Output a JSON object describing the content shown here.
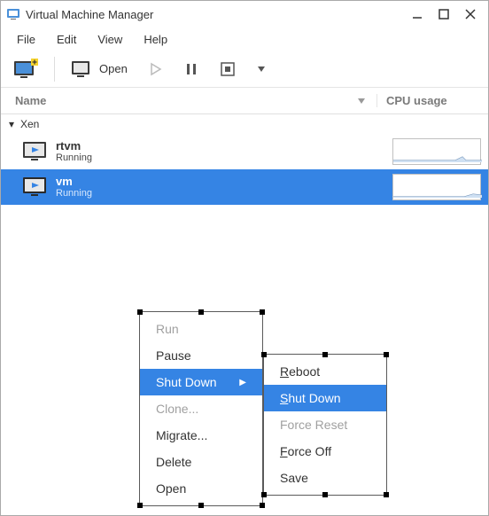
{
  "window": {
    "title": "Virtual Machine Manager"
  },
  "menubar": [
    "File",
    "Edit",
    "View",
    "Help"
  ],
  "toolbar": {
    "open_label": "Open"
  },
  "headers": {
    "name": "Name",
    "cpu": "CPU usage"
  },
  "connection": {
    "label": "Xen"
  },
  "vms": [
    {
      "name": "rtvm",
      "status": "Running",
      "selected": false
    },
    {
      "name": "vm",
      "status": "Running",
      "selected": true
    }
  ],
  "context_menu": [
    {
      "label": "Run",
      "disabled": true
    },
    {
      "label": "Pause",
      "disabled": false
    },
    {
      "label": "Shut Down",
      "disabled": false,
      "highlight": true,
      "submenu": true
    },
    {
      "label": "Clone...",
      "disabled": true
    },
    {
      "label": "Migrate...",
      "disabled": false
    },
    {
      "label": "Delete",
      "disabled": false
    },
    {
      "label": "Open",
      "disabled": false
    }
  ],
  "sub_menu": [
    {
      "label": "Reboot",
      "disabled": false
    },
    {
      "label": "Shut Down",
      "disabled": false,
      "highlight": true
    },
    {
      "label": "Force Reset",
      "disabled": true
    },
    {
      "label": "Force Off",
      "disabled": false
    },
    {
      "label": "Save",
      "disabled": false
    }
  ]
}
